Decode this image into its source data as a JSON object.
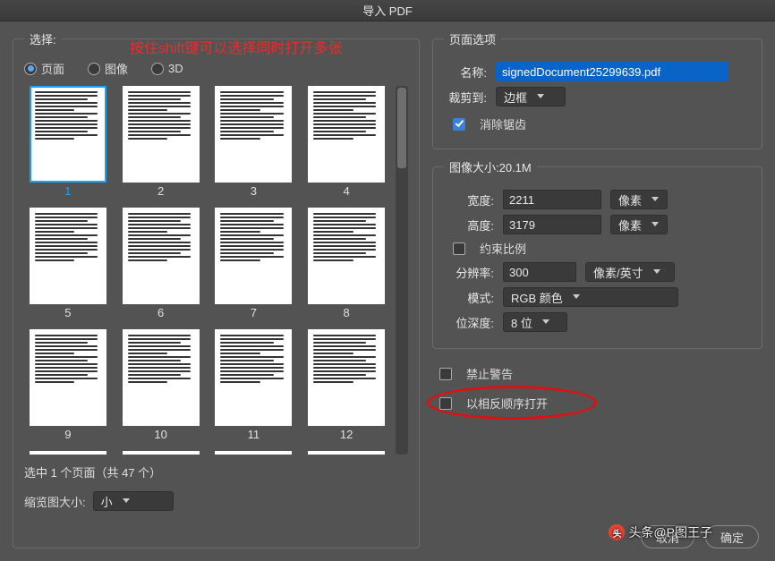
{
  "window": {
    "title": "导入 PDF"
  },
  "annotation": "按住shift键可以选择同时打开多张",
  "select_group_label": "选择:",
  "radios": {
    "page": "页面",
    "image": "图像",
    "threed": "3D",
    "selected": "page"
  },
  "thumbs": {
    "count_visible": 12,
    "labels": [
      "1",
      "2",
      "3",
      "4",
      "5",
      "6",
      "7",
      "8",
      "9",
      "10",
      "11",
      "12"
    ],
    "selected_index": 0
  },
  "status_text": "选中 1 个页面（共 47 个）",
  "thumb_size_label": "缩览图大小:",
  "thumb_size_value": "小",
  "page_options": {
    "legend": "页面选项",
    "name_label": "名称:",
    "name_value": "signedDocument25299639.pdf",
    "crop_label": "裁剪到:",
    "crop_value": "边框",
    "antialias_label": "消除锯齿",
    "antialias_checked": true
  },
  "image_size": {
    "legend": "图像大小:20.1M",
    "width_label": "宽度:",
    "width_value": "2211",
    "width_unit": "像素",
    "height_label": "高度:",
    "height_value": "3179",
    "height_unit": "像素",
    "constrain_label": "约束比例",
    "constrain_checked": false,
    "resolution_label": "分辨率:",
    "resolution_value": "300",
    "resolution_unit": "像素/英寸",
    "mode_label": "模式:",
    "mode_value": "RGB 颜色",
    "depth_label": "位深度:",
    "depth_value": "8 位"
  },
  "bottom_checks": {
    "suppress_label": "禁止警告",
    "suppress_checked": false,
    "reverse_label": "以相反顺序打开",
    "reverse_checked": false
  },
  "buttons": {
    "cancel": "取消",
    "ok": "确定"
  },
  "watermark": "头条@P图王子"
}
